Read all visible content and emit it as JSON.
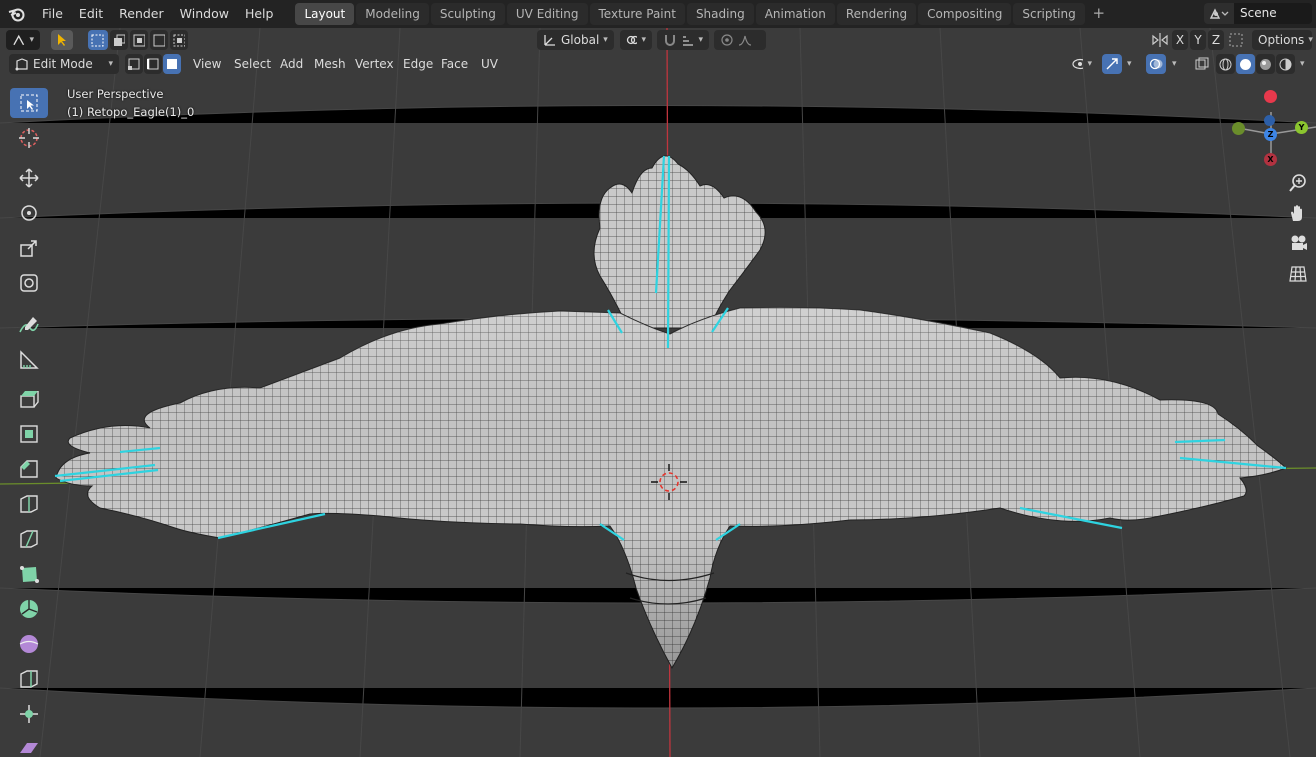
{
  "menubar": {
    "items": [
      "File",
      "Edit",
      "Render",
      "Window",
      "Help"
    ],
    "workspaces": [
      "Layout",
      "Modeling",
      "Sculpting",
      "UV Editing",
      "Texture Paint",
      "Shading",
      "Animation",
      "Rendering",
      "Compositing",
      "Scripting"
    ],
    "active_workspace": "Layout",
    "add_tab": "+",
    "scene_name": "Scene"
  },
  "header": {
    "transform_orientation": "Global",
    "axes": [
      "X",
      "Y",
      "Z"
    ],
    "options_label": "Options",
    "mode": "Edit Mode",
    "view_menus": [
      "View",
      "Select",
      "Add",
      "Mesh",
      "Vertex",
      "Edge",
      "Face",
      "UV"
    ]
  },
  "overlay": {
    "perspective": "User Perspective",
    "object_name": "(1) Retopo_Eagle(1)_0"
  },
  "toolbar": {
    "tools": [
      "select-box-tool",
      "cursor-tool",
      "move-tool",
      "rotate-tool",
      "scale-tool",
      "transform-tool",
      "annotate-tool",
      "measure-tool",
      "extrude-tool",
      "inset-tool",
      "bevel-tool",
      "loop-cut-tool",
      "knife-tool",
      "poly-build-tool",
      "spin-tool",
      "smooth-tool",
      "edge-slide-tool",
      "shrink-fatten-tool",
      "shear-tool"
    ],
    "active_tool": "select-box-tool"
  },
  "gizmo": {
    "labels": [
      "Y",
      "Z",
      "X"
    ],
    "colors": {
      "x": "#e8394c",
      "y": "#8bc52f",
      "z": "#3d85e6",
      "accent": "#4772b3",
      "seam": "#2ed3e0"
    }
  }
}
